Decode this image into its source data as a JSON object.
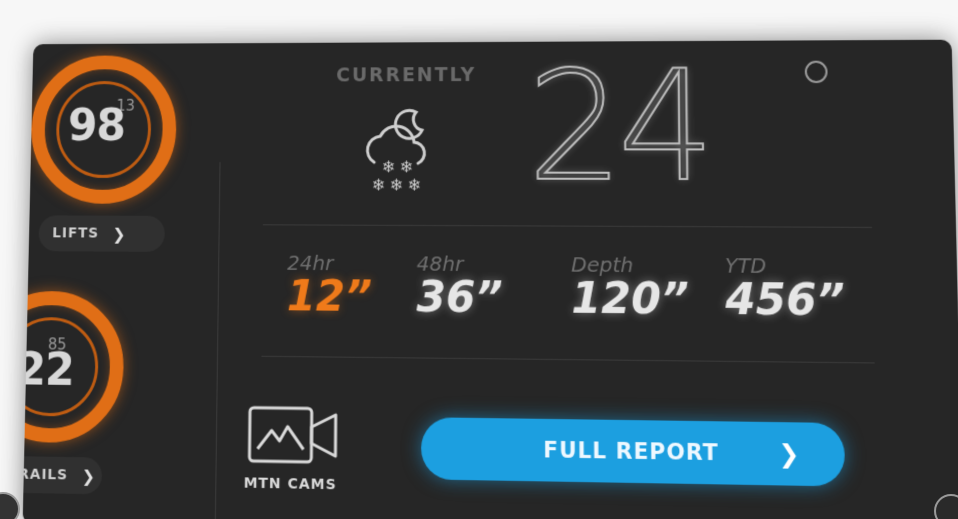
{
  "gauges": [
    {
      "value": "98",
      "total": "13",
      "pill_label": "LIFTS"
    },
    {
      "value": "22",
      "total": "85",
      "pill_label": "TRAILS"
    }
  ],
  "current": {
    "label": "CURRENTLY",
    "temperature": "24",
    "icon": "snow-cloud-moon-icon"
  },
  "snowfall": [
    {
      "label": "24hr",
      "value": "12”"
    },
    {
      "label": "48hr",
      "value": "36”"
    },
    {
      "label": "Depth",
      "value": "120”"
    },
    {
      "label": "YTD",
      "value": "456”"
    }
  ],
  "cams": {
    "label": "MTN CAMS",
    "icon": "mountain-camera-icon"
  },
  "report_button": {
    "label": "FULL REPORT"
  },
  "colors": {
    "accent": "#e06e16",
    "button": "#1c9fe0",
    "panel": "#262626"
  }
}
